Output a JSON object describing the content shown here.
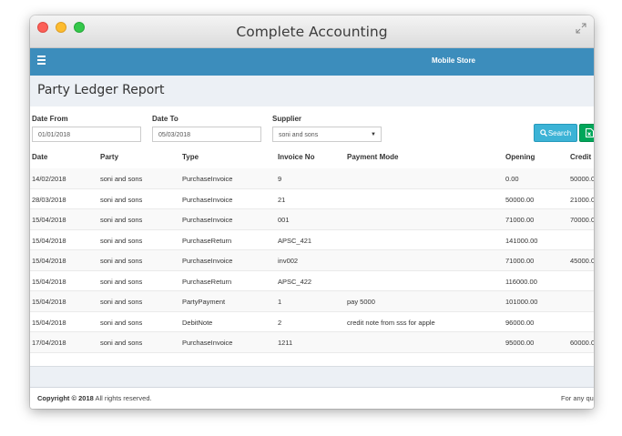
{
  "window": {
    "title": "Complete Accounting"
  },
  "navbar": {
    "store": "Mobile Store"
  },
  "page": {
    "title": "Party Ledger Report"
  },
  "filters": {
    "date_from": {
      "label": "Date From",
      "value": "01/01/2018"
    },
    "date_to": {
      "label": "Date To",
      "value": "05/03/2018"
    },
    "supplier": {
      "label": "Supplier",
      "value": "soni and sons"
    },
    "search_label": "Search"
  },
  "table": {
    "headers": {
      "date": "Date",
      "party": "Party",
      "type": "Type",
      "invoice": "Invoice No",
      "payment": "Payment Mode",
      "opening": "Opening",
      "credit": "Credit"
    },
    "rows": [
      {
        "date": "14/02/2018",
        "party": "soni and sons",
        "type": "PurchaseInvoice",
        "invoice": "9",
        "payment": "",
        "opening": "0.00",
        "credit": "50000.0"
      },
      {
        "date": "28/03/2018",
        "party": "soni and sons",
        "type": "PurchaseInvoice",
        "invoice": "21",
        "payment": "",
        "opening": "50000.00",
        "credit": "21000.0"
      },
      {
        "date": "15/04/2018",
        "party": "soni and sons",
        "type": "PurchaseInvoice",
        "invoice": "001",
        "payment": "",
        "opening": "71000.00",
        "credit": "70000.0"
      },
      {
        "date": "15/04/2018",
        "party": "soni and sons",
        "type": "PurchaseReturn",
        "invoice": "APSC_421",
        "payment": "",
        "opening": "141000.00",
        "credit": ""
      },
      {
        "date": "15/04/2018",
        "party": "soni and sons",
        "type": "PurchaseInvoice",
        "invoice": "inv002",
        "payment": "",
        "opening": "71000.00",
        "credit": "45000.0"
      },
      {
        "date": "15/04/2018",
        "party": "soni and sons",
        "type": "PurchaseReturn",
        "invoice": "APSC_422",
        "payment": "",
        "opening": "116000.00",
        "credit": ""
      },
      {
        "date": "15/04/2018",
        "party": "soni and sons",
        "type": "PartyPayment",
        "invoice": "1",
        "payment": "pay 5000",
        "opening": "101000.00",
        "credit": ""
      },
      {
        "date": "15/04/2018",
        "party": "soni and sons",
        "type": "DebitNote",
        "invoice": "2",
        "payment": "credit note from sss for apple",
        "opening": "96000.00",
        "credit": ""
      },
      {
        "date": "17/04/2018",
        "party": "soni and sons",
        "type": "PurchaseInvoice",
        "invoice": "1211",
        "payment": "",
        "opening": "95000.00",
        "credit": "60000.0"
      }
    ]
  },
  "footer": {
    "copyright_prefix": "Copyright © 2018",
    "copyright_suffix": " All rights reserved.",
    "right_text": "For any qu"
  },
  "icons": {
    "menu": "hamburger-icon",
    "search": "search-icon",
    "export": "excel-icon",
    "resize": "expand-icon",
    "dropdown": "caret-down-icon"
  },
  "colors": {
    "navbar": "#3c8dbc",
    "search_button": "#3cb3d6",
    "export_button": "#00a65a",
    "page_header": "#ecf0f5"
  }
}
